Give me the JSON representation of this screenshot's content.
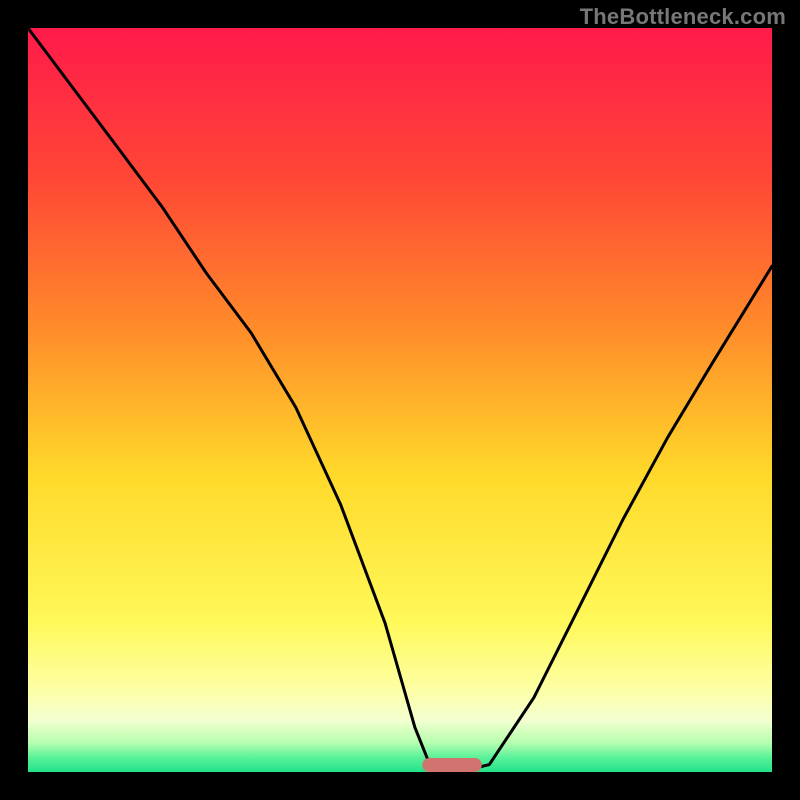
{
  "watermark": "TheBottleneck.com",
  "chart_data": {
    "type": "line",
    "title": "",
    "xlabel": "",
    "ylabel": "",
    "xlim": [
      0,
      100
    ],
    "ylim": [
      0,
      100
    ],
    "grid": false,
    "legend": false,
    "background_gradient": {
      "stops": [
        {
          "offset": 0,
          "color": "#ff1a4a"
        },
        {
          "offset": 20,
          "color": "#ff4636"
        },
        {
          "offset": 40,
          "color": "#ff8a2a"
        },
        {
          "offset": 60,
          "color": "#ffd92a"
        },
        {
          "offset": 80,
          "color": "#fff95a"
        },
        {
          "offset": 89,
          "color": "#fdffa6"
        },
        {
          "offset": 93,
          "color": "#f3ffd0"
        },
        {
          "offset": 96,
          "color": "#b8ffb0"
        },
        {
          "offset": 98,
          "color": "#5cf29a"
        },
        {
          "offset": 100,
          "color": "#21e28a"
        }
      ]
    },
    "series": [
      {
        "name": "bottleneck-curve",
        "x": [
          0,
          6,
          12,
          18,
          24,
          30,
          36,
          42,
          48,
          52,
          54,
          56,
          58,
          62,
          64,
          68,
          74,
          80,
          86,
          92,
          100
        ],
        "values": [
          100,
          92,
          84,
          76,
          67,
          59,
          49,
          36,
          20,
          6,
          1,
          0,
          0,
          1,
          4,
          10,
          22,
          34,
          45,
          55,
          68
        ]
      }
    ],
    "marker": {
      "name": "optimum-marker",
      "x_center": 57,
      "width": 8,
      "color": "#d1736f"
    }
  }
}
